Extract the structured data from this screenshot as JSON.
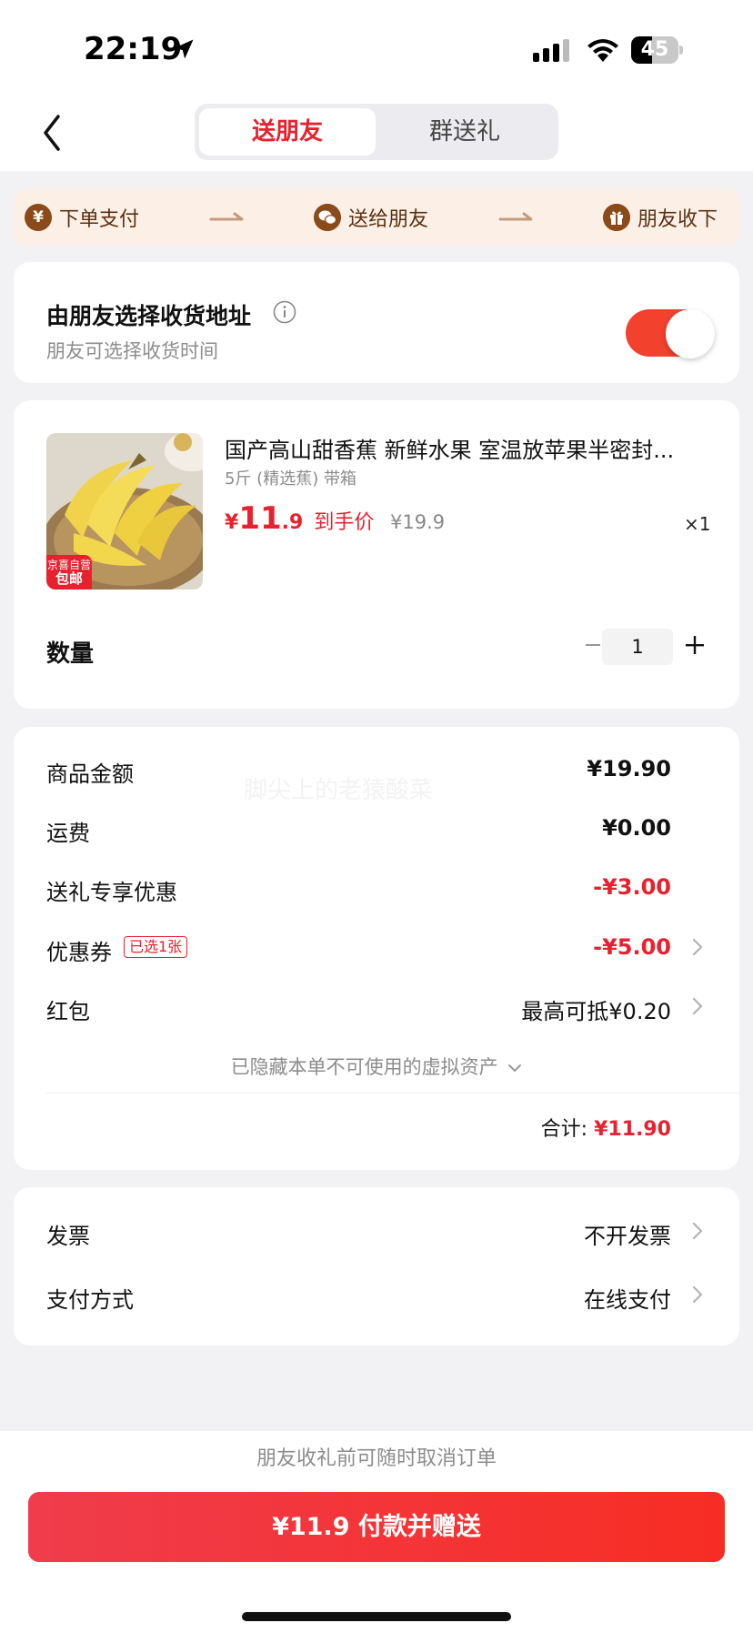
{
  "status_bar": {
    "time": "22:19",
    "battery": "45",
    "battery_level": 0.45
  },
  "header": {
    "tabs": [
      {
        "label": "送朋友",
        "active": true
      },
      {
        "label": "群送礼",
        "active": false
      }
    ]
  },
  "steps": [
    {
      "icon": "¥",
      "icon_name": "yuan-circle-icon",
      "label": "下单支付"
    },
    {
      "icon": "",
      "icon_name": "wechat-icon",
      "label": "送给朋友"
    },
    {
      "icon": "",
      "icon_name": "gift-icon",
      "label": "朋友收下"
    }
  ],
  "address_card": {
    "title": "由朋友选择收货地址",
    "subtitle": "朋友可选择收货时间",
    "toggle_on": true
  },
  "product": {
    "title": "国产高山甜香蕉  新鲜水果 室温放苹果半密封...",
    "spec": "5斤 (精选蕉) 带箱",
    "price_symbol": "¥",
    "price_int": "11",
    "price_dec": ".9",
    "price_label": "到手价",
    "original_price": "¥19.9",
    "qty_mark": "×1",
    "badge_line1": "京喜自营",
    "badge_line2": "包邮",
    "quantity_label": "数量",
    "quantity": "1"
  },
  "summary": {
    "rows": [
      {
        "label": "商品金额",
        "value": "¥19.90"
      },
      {
        "label": "运费",
        "value": "¥0.00"
      },
      {
        "label": "送礼专享优惠",
        "value": "-¥3.00"
      },
      {
        "label": "优惠券",
        "tag": "已选1张",
        "value": "-¥5.00"
      },
      {
        "label": "红包",
        "value": "最高可抵¥0.20"
      }
    ],
    "hidden_note": "已隐藏本单不可使用的虚拟资产",
    "total_label": "合计:",
    "total_value": "¥11.90",
    "watermark": "脚尖上的老猿酸菜"
  },
  "options": {
    "rows": [
      {
        "label": "发票",
        "value": "不开发票"
      },
      {
        "label": "支付方式",
        "value": "在线支付"
      }
    ]
  },
  "footer": {
    "note": "朋友收礼前可随时取消订单",
    "pay_button": "¥11.9 付款并赠送"
  },
  "colors": {
    "accent": "#e8212e",
    "step_brown": "#8a4a1a",
    "step_bg": "#fcf0e6"
  }
}
